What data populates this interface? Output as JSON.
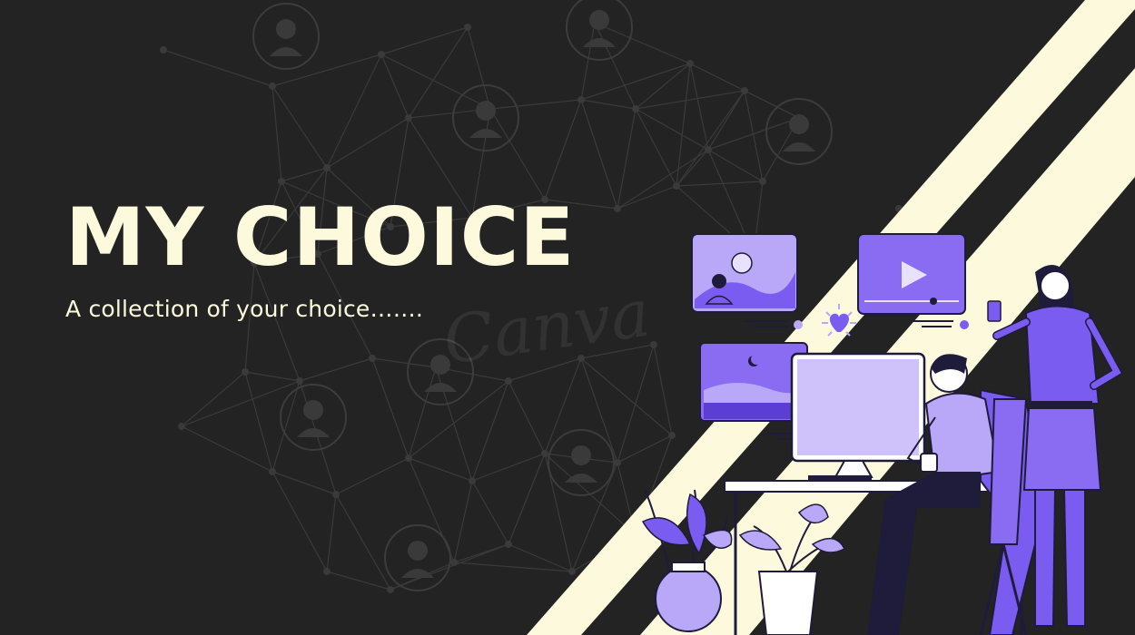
{
  "hero": {
    "title": "MY CHOICE",
    "subtitle": "A collection of your choice……."
  },
  "watermark": {
    "text": "Canva"
  },
  "colors": {
    "background": "#232323",
    "cream": "#fdf9dd",
    "purple": "#7b5cf0",
    "light_purple": "#b9a8f7",
    "dark_navy": "#1f1b3a"
  }
}
